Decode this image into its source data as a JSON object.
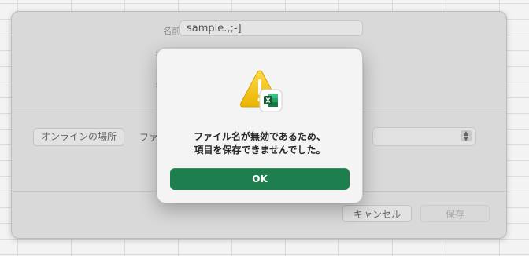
{
  "sheet": {
    "name_label": "名前:",
    "name_value": "sample.,;-]",
    "online_button": "オンラインの場所",
    "format_label": "ファ",
    "cancel_label": "キャンセル",
    "save_label": "保存"
  },
  "alert": {
    "line1": "ファイル名が無効であるため、",
    "line2": "項目を保存できませんでした。",
    "ok_label": "OK",
    "badge_letter": "X"
  },
  "colors": {
    "ok_button": "#1f7e4e",
    "warning_triangle": "#f2c21a",
    "excel_green": "#1d7044"
  }
}
